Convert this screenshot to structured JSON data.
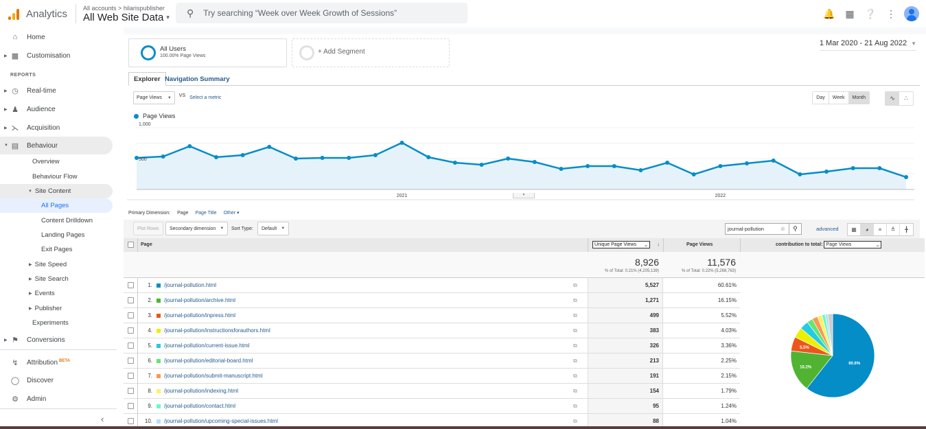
{
  "topbar": {
    "app_name": "Analytics",
    "breadcrumb": "All accounts > hilarispublisher",
    "property": "All Web Site Data",
    "search_placeholder": "Try searching “Week over Week Growth of Sessions”",
    "icons": [
      "bell-icon",
      "apps-icon",
      "help-icon",
      "more-vert-icon",
      "account-avatar"
    ]
  },
  "sidebar": {
    "items_top": [
      {
        "label": "Home",
        "icon": "home-icon"
      },
      {
        "label": "Customisation",
        "icon": "dashboard-icon"
      }
    ],
    "reports_label": "REPORTS",
    "reports": [
      {
        "label": "Real-time",
        "icon": "clock-icon"
      },
      {
        "label": "Audience",
        "icon": "person-icon"
      },
      {
        "label": "Acquisition",
        "icon": "acquisition-icon"
      },
      {
        "label": "Behaviour",
        "icon": "behaviour-icon"
      }
    ],
    "behaviour_sub": [
      "Overview",
      "Behaviour Flow",
      "Site Content"
    ],
    "site_content_sub": [
      "All Pages",
      "Content Drilldown",
      "Landing Pages",
      "Exit Pages"
    ],
    "behaviour_more": [
      "Site Speed",
      "Site Search",
      "Events",
      "Publisher",
      "Experiments"
    ],
    "conversions": "Conversions",
    "bottom": [
      {
        "label": "Attribution",
        "icon": "attribution-icon",
        "badge": "BETA"
      },
      {
        "label": "Discover",
        "icon": "lightbulb-icon"
      },
      {
        "label": "Admin",
        "icon": "gear-icon"
      }
    ]
  },
  "segments": {
    "all_users": "All Users",
    "all_users_sub": "100.00% Page Views",
    "add_segment": "+ Add Segment"
  },
  "date_range": "1 Mar 2020 - 21 Aug 2022",
  "tabs": {
    "explorer": "Explorer",
    "navigation_summary": "Navigation Summary"
  },
  "metric": {
    "selected": "Page Views",
    "vs": "VS",
    "select_metric": "Select a metric"
  },
  "granularity": {
    "day": "Day",
    "week": "Week",
    "month": "Month",
    "selected": "Month"
  },
  "chart_data": {
    "type": "area",
    "series": [
      {
        "name": "Page Views",
        "color": "#058dc7",
        "values": [
          511,
          533,
          700,
          522,
          556,
          689,
          500,
          511,
          511,
          556,
          756,
          522,
          433,
          400,
          500,
          444,
          333,
          378,
          378,
          311,
          433,
          244,
          378,
          422,
          467,
          244,
          289,
          344,
          344,
          200
        ]
      }
    ],
    "x": [
      "Mar 2020",
      "Apr 2020",
      "May 2020",
      "Jun 2020",
      "Jul 2020",
      "Aug 2020",
      "Sep 2020",
      "Oct 2020",
      "Nov 2020",
      "Dec 2020",
      "Jan 2021",
      "Feb 2021",
      "Mar 2021",
      "Apr 2021",
      "May 2021",
      "Jun 2021",
      "Jul 2021",
      "Aug 2021",
      "Sep 2021",
      "Oct 2021",
      "Nov 2021",
      "Dec 2021",
      "Jan 2022",
      "Feb 2022",
      "Mar 2022",
      "Apr 2022",
      "May 2022",
      "Jun 2022",
      "Jul 2022",
      "Aug 2022"
    ],
    "x_tick_labels": [
      {
        "index": 10,
        "label": "2021"
      },
      {
        "index": 22,
        "label": "2022"
      }
    ],
    "y_tick_labels": [
      "1,000",
      "500"
    ],
    "ylim": [
      0,
      1000
    ],
    "legend": "Page Views",
    "grid": true
  },
  "primary_dimension": {
    "label": "Primary Dimension:",
    "current": "Page",
    "options": [
      "Page Title",
      "Other"
    ]
  },
  "toolbar": {
    "plot_rows": "Plot Rows",
    "secondary_dimension": "Secondary dimension",
    "sort_type_label": "Sort Type:",
    "sort_type_value": "Default",
    "filter_value": "journal-pollution",
    "advanced": "advanced"
  },
  "table": {
    "col_page": "Page",
    "col_upv_select": "Unique Page Views",
    "col_pv": "Page Views",
    "contribution_label": "contribution to total:",
    "contribution_select": "Page Views",
    "totals": {
      "upv": "8,926",
      "upv_sub": "% of Total: 0.21% (4,205,139)",
      "pv": "11,576",
      "pv_sub": "% of Total: 0.22% (5,268,763)"
    },
    "rows": [
      {
        "rank": "1.",
        "page": "/journal-pollution.html",
        "color": "#058dc7",
        "upv": "5,527",
        "pct": "60.61%"
      },
      {
        "rank": "2.",
        "page": "/journal-pollution/archive.html",
        "color": "#50b432",
        "upv": "1,271",
        "pct": "16.15%"
      },
      {
        "rank": "3.",
        "page": "/journal-pollution/inpress.html",
        "color": "#ed561b",
        "upv": "499",
        "pct": "5.52%"
      },
      {
        "rank": "4.",
        "page": "/journal-pollution/instructionsforauthors.html",
        "color": "#edef00",
        "upv": "383",
        "pct": "4.03%"
      },
      {
        "rank": "5.",
        "page": "/journal-pollution/current-issue.html",
        "color": "#24cbe5",
        "upv": "326",
        "pct": "3.36%"
      },
      {
        "rank": "6.",
        "page": "/journal-pollution/editorial-board.html",
        "color": "#64e572",
        "upv": "213",
        "pct": "2.25%"
      },
      {
        "rank": "7.",
        "page": "/journal-pollution/submit-manuscript.html",
        "color": "#ff9655",
        "upv": "191",
        "pct": "2.15%"
      },
      {
        "rank": "8.",
        "page": "/journal-pollution/indexing.html",
        "color": "#fff263",
        "upv": "154",
        "pct": "1.79%"
      },
      {
        "rank": "9.",
        "page": "/journal-pollution/contact.html",
        "color": "#6af9c4",
        "upv": "95",
        "pct": "1.24%"
      },
      {
        "rank": "10.",
        "page": "/journal-pollution/upcoming-special-issues.html",
        "color": "#b2deff",
        "upv": "88",
        "pct": "1.04%"
      }
    ],
    "pie": {
      "slices": [
        60.61,
        16.15,
        5.52,
        4.03,
        3.36,
        2.25,
        2.15,
        1.79,
        1.24,
        1.04,
        1.86
      ],
      "colors": [
        "#058dc7",
        "#50b432",
        "#ed561b",
        "#edef00",
        "#24cbe5",
        "#64e572",
        "#ff9655",
        "#fff263",
        "#6af9c4",
        "#b2deff",
        "#cccccc"
      ],
      "labels": [
        "60.6%",
        "16.2%",
        "5.5%"
      ]
    }
  }
}
